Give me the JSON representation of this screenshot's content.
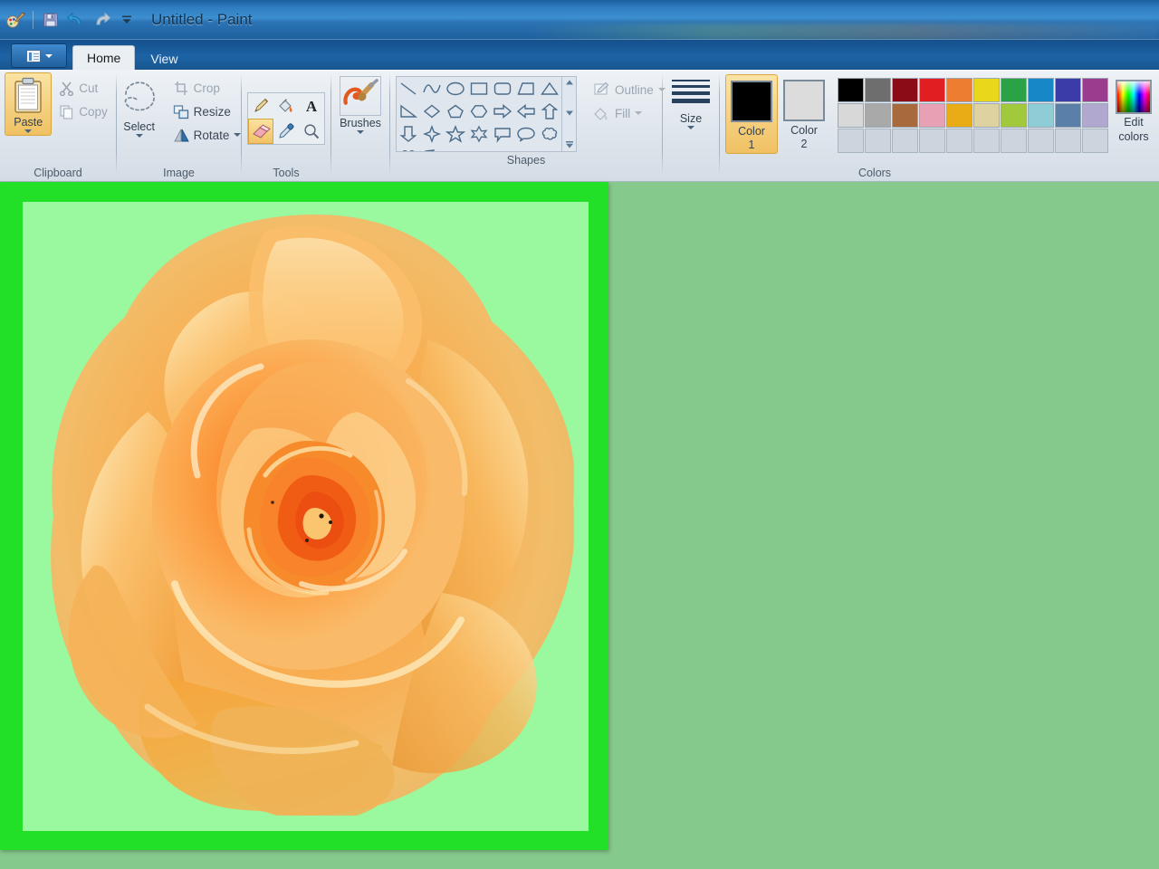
{
  "window": {
    "title": "Untitled - Paint",
    "quick_access": [
      {
        "name": "paint-app-icon",
        "label": "Paint"
      },
      {
        "name": "save-icon",
        "label": "Save"
      },
      {
        "name": "undo-icon",
        "label": "Undo"
      },
      {
        "name": "redo-icon",
        "label": "Redo"
      },
      {
        "name": "customize-qat-icon",
        "label": "Customize Quick Access Toolbar"
      }
    ]
  },
  "tabs": {
    "menu_button_label": "File",
    "items": [
      {
        "label": "Home",
        "active": true
      },
      {
        "label": "View",
        "active": false
      }
    ]
  },
  "ribbon": {
    "groups": [
      {
        "name": "clipboard",
        "label": "Clipboard",
        "paste": {
          "label": "Paste",
          "icon": "clipboard-icon",
          "selected": true
        },
        "commands": [
          {
            "label": "Cut",
            "icon": "scissors-icon",
            "disabled": true
          },
          {
            "label": "Copy",
            "icon": "copy-icon",
            "disabled": true
          }
        ]
      },
      {
        "name": "image",
        "label": "Image",
        "select": {
          "label": "Select",
          "icon": "lasso-select-icon"
        },
        "commands": [
          {
            "label": "Crop",
            "icon": "crop-icon",
            "disabled": true
          },
          {
            "label": "Resize",
            "icon": "resize-icon",
            "disabled": false
          },
          {
            "label": "Rotate",
            "icon": "rotate-icon",
            "disabled": false,
            "dropdown": true
          }
        ]
      },
      {
        "name": "tools",
        "label": "Tools",
        "tools": [
          {
            "name": "pencil-icon",
            "label": "Pencil",
            "selected": false
          },
          {
            "name": "fill-with-color-icon",
            "label": "Fill with color",
            "selected": false
          },
          {
            "name": "text-icon",
            "label": "Text",
            "selected": false
          },
          {
            "name": "eraser-icon",
            "label": "Eraser",
            "selected": true
          },
          {
            "name": "color-picker-icon",
            "label": "Color picker",
            "selected": false
          },
          {
            "name": "magnifier-icon",
            "label": "Magnifier",
            "selected": false
          }
        ]
      },
      {
        "name": "brushes",
        "label": "",
        "brushes": {
          "label": "Brushes",
          "icon": "brush-icon"
        }
      },
      {
        "name": "shapes",
        "label": "Shapes",
        "shapes": [
          "line-shape",
          "curve-shape",
          "oval-shape",
          "rectangle-shape",
          "rounded-rectangle-shape",
          "quadrilateral-shape",
          "triangle-shape",
          "right-triangle-shape",
          "diamond-shape",
          "pentagon-shape",
          "hexagon-shape",
          "right-arrow-shape",
          "left-arrow-shape",
          "up-arrow-shape",
          "down-arrow-shape",
          "four-point-star-shape",
          "five-point-star-shape",
          "six-point-star-shape",
          "rectangular-callout-shape",
          "rounded-callout-shape",
          "cloud-callout-shape",
          "heart-shape",
          "lightning-shape"
        ],
        "outline": {
          "label": "Outline",
          "icon": "outline-icon",
          "disabled": true
        },
        "fill": {
          "label": "Fill",
          "icon": "fill-icon",
          "disabled": true
        }
      },
      {
        "name": "size",
        "label": "",
        "size": {
          "label": "Size",
          "icon": "size-icon",
          "widths": [
            2,
            3,
            4,
            5
          ]
        }
      },
      {
        "name": "colors",
        "label": "Colors",
        "color1": {
          "label_line1": "Color",
          "label_line2": "1",
          "value": "#000000",
          "selected": true
        },
        "color2": {
          "label_line1": "Color",
          "label_line2": "2",
          "value": "#dcdcdc",
          "selected": false
        },
        "palette_row1": [
          "#000000",
          "#6e6e6e",
          "#8b0c16",
          "#e11f22",
          "#ed7d31",
          "#e8d71a",
          "#2ba245",
          "#1887c8",
          "#3c3ca8",
          "#9b3d8f"
        ],
        "palette_row2": [
          "#d8d8d8",
          "#a9a9a9",
          "#a86a3c",
          "#e8a0b5",
          "#e9ac16",
          "#ddd2a0",
          "#a2c83c",
          "#8fcdd6",
          "#5a7fa8",
          "#b0a8cf"
        ],
        "palette_row3": [
          "",
          "",
          "",
          "",
          "",
          "",
          "",
          "",
          "",
          ""
        ],
        "edit_colors": {
          "label_line1": "Edit",
          "label_line2": "colors",
          "icon": "rainbow-icon"
        }
      }
    ]
  },
  "canvas": {
    "name": "paint-canvas",
    "frame_color": "#22e028",
    "background_color": "#9af89e",
    "outside_color": "#86c98c",
    "image": {
      "name": "rose-image",
      "description": "Orange rose flower"
    }
  }
}
